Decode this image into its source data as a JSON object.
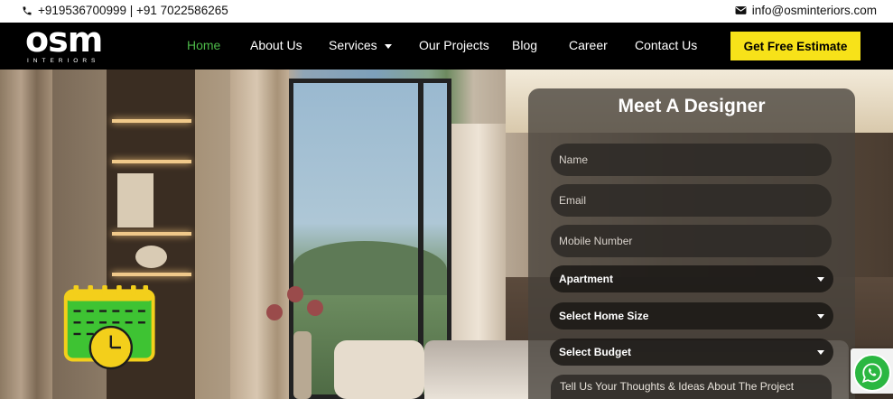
{
  "topbar": {
    "phone": "+919536700999 | +91 7022586265",
    "email": "info@osminteriors.com"
  },
  "brand": {
    "logo_text": "osm",
    "logo_sub": "INTERIORS"
  },
  "nav": {
    "items": [
      {
        "label": "Home",
        "active": true
      },
      {
        "label": "About Us"
      },
      {
        "label": "Services",
        "has_dropdown": true
      },
      {
        "label": "Our Projects"
      },
      {
        "label": "Blog"
      },
      {
        "label": "Career"
      },
      {
        "label": "Contact Us"
      }
    ],
    "cta": "Get Free Estimate"
  },
  "form": {
    "title": "Meet A Designer",
    "name_placeholder": "Name",
    "email_placeholder": "Email",
    "mobile_placeholder": "Mobile Number",
    "property_type": "Apartment",
    "home_size": "Select Home Size",
    "budget": "Select Budget",
    "message_placeholder": "Tell Us Your Thoughts & Ideas About The Project"
  },
  "colors": {
    "accent_green": "#4cb848",
    "cta_yellow": "#f7e219",
    "nav_bg": "#000000"
  },
  "icons": {
    "phone": "phone-icon",
    "email": "envelope-icon",
    "floating": "whatsapp-icon",
    "calendar": "calendar-clock-icon"
  }
}
